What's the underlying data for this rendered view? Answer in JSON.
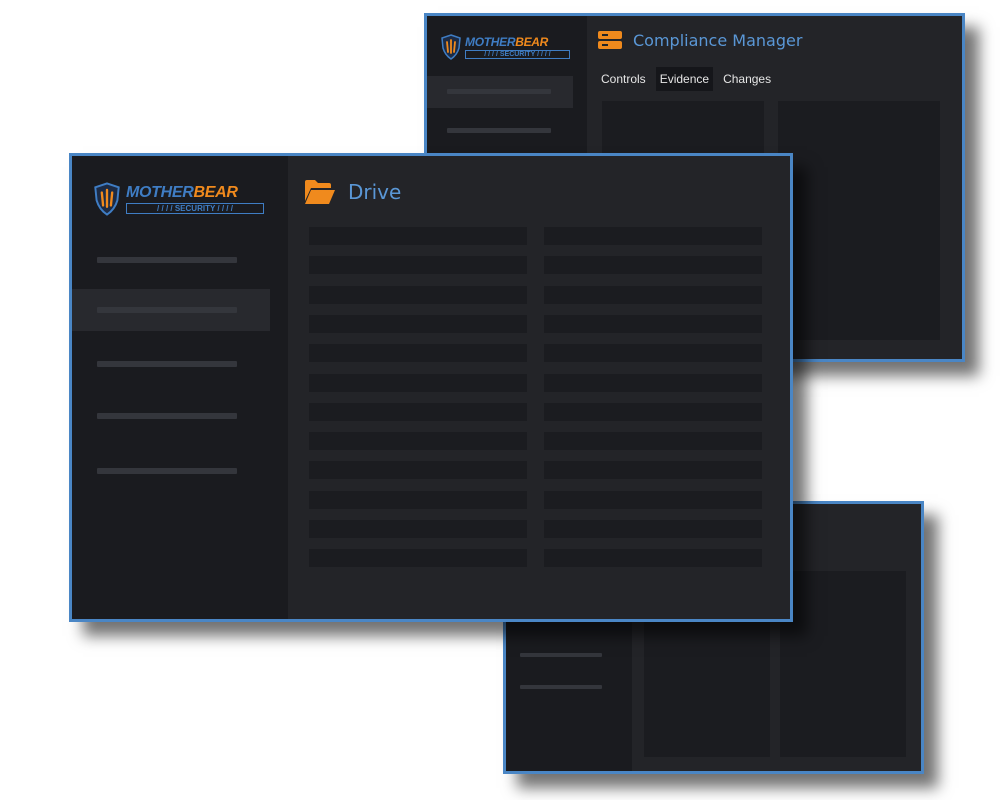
{
  "brand": {
    "word_left": "MOTHER",
    "word_right": "BEAR",
    "subtitle": "SECURITY",
    "colors": {
      "blue": "#3f7dc4",
      "orange": "#f08a1d"
    }
  },
  "compliance_window": {
    "title": "Compliance Manager",
    "icon": "server-stack-icon",
    "tabs": [
      {
        "label": "Controls",
        "active": false
      },
      {
        "label": "Evidence",
        "active": true
      },
      {
        "label": "Changes",
        "active": false
      }
    ]
  },
  "drive_window": {
    "title": "Drive",
    "icon": "folder-open-icon",
    "nav_count": 5,
    "active_nav_index": 1,
    "rows_per_column": 12
  },
  "third_window": {
    "nav_count": 2
  },
  "colors": {
    "frame_border": "#4a86c5",
    "accent_orange": "#f08a1d",
    "title_blue": "#5a97d6",
    "sidebar_bg": "#1a1b1f",
    "main_bg": "#232428"
  }
}
